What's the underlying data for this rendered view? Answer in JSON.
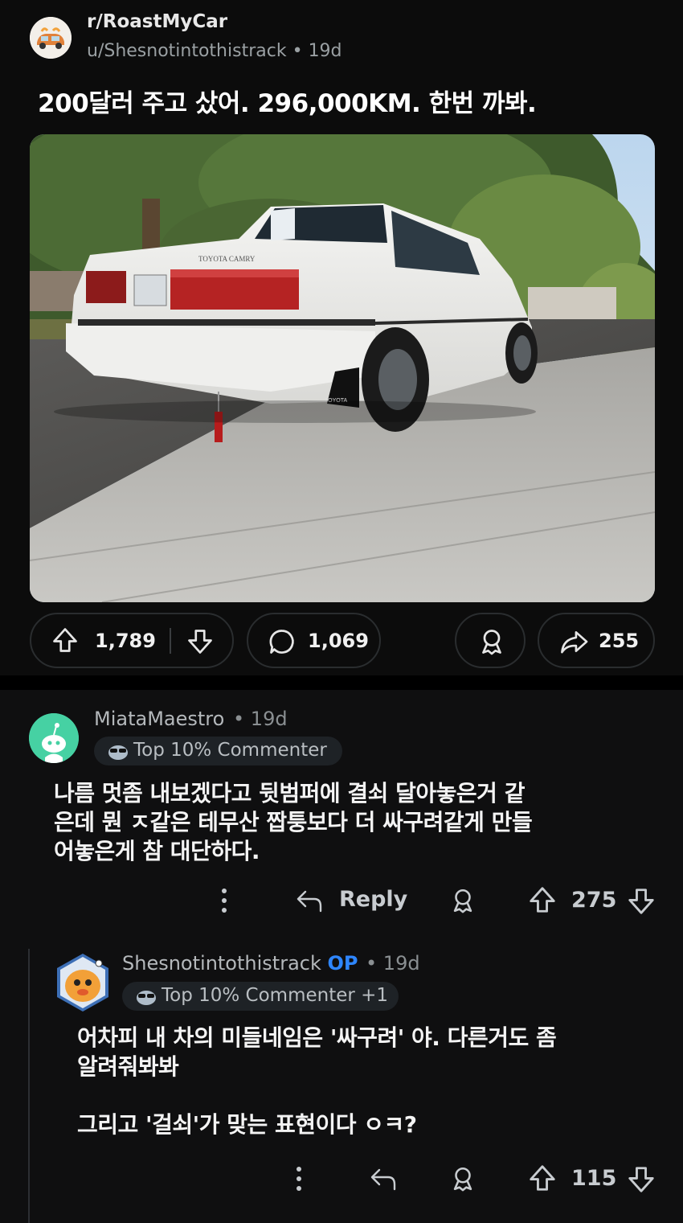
{
  "post": {
    "subreddit": "r/RoastMyCar",
    "author": "u/Shesnotintothistrack",
    "age": "19d",
    "title": "200달러 주고 샀어. 296,000KM. 한번 까봐.",
    "image": {
      "plate_text": "",
      "brand_text": "TOYOTA CAMRY",
      "mudflap_text": "TOYOTA"
    },
    "upvotes": "1,789",
    "comments_count": "1,069",
    "shares": "255"
  },
  "comments": [
    {
      "author": "MiataMaestro",
      "age": "19d",
      "badge": "Top 10% Commenter",
      "body": "나름 멋좀 내보겠다고 뒷범퍼에 결쇠 달아놓은거 같\n은데 뭔 ㅈ같은 테무산 짭퉁보다 더 싸구려같게 만들\n어놓은게 참 대단하다.",
      "reply_label": "Reply",
      "score": "275"
    },
    {
      "author": "Shesnotintothistrack",
      "op_label": "OP",
      "age": "19d",
      "badge": "Top 10% Commenter +1",
      "body": "어차피 내 차의 미들네임은 '싸구려' 야. 다른거도 좀\n알려줘봐봐\n\n그리고 '걸쇠'가 맞는 표현이다 ㅇㅋ?",
      "score": "115"
    }
  ],
  "icons": [
    "subreddit-avatar-icon",
    "upvote-icon",
    "downvote-icon",
    "comment-icon",
    "award-icon",
    "share-icon",
    "more-icon",
    "reply-icon",
    "snoo-avatar-icon",
    "sunglasses-badge-icon"
  ],
  "colors": {
    "background": "#0c0c0c",
    "op_blue": "#2e86ff",
    "avatar_green": "#46d1a3",
    "pill_border": "#2a2d2f"
  }
}
